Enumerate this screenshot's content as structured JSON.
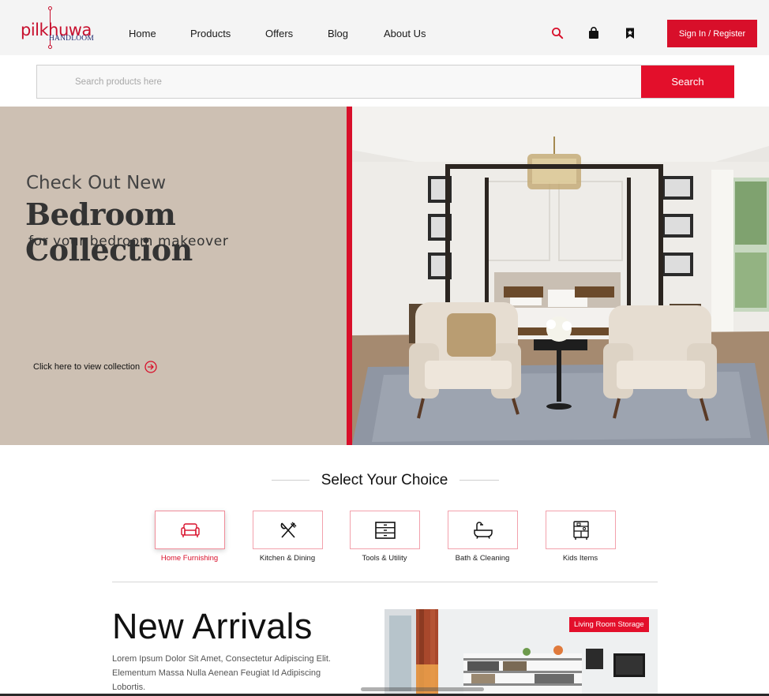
{
  "header": {
    "logo": {
      "main": "pilkhuwa",
      "sub": "HANDLOOM"
    },
    "nav": [
      "Home",
      "Products",
      "Offers",
      "Blog",
      "About Us"
    ],
    "icons": [
      "search-icon",
      "shopping-bag-icon",
      "bookmark-icon"
    ],
    "signin_label": "Sign In / Register"
  },
  "search": {
    "placeholder": "Search products here",
    "button_label": "Search"
  },
  "hero": {
    "line1": "Check Out New",
    "line2": "Bedroom Collection",
    "line3": "for your bedroom makeover",
    "cta": "Click here to view collection"
  },
  "choice": {
    "title": "Select Your Choice",
    "categories": [
      {
        "label": "Home Furnishing",
        "icon": "sofa-icon",
        "active": true
      },
      {
        "label": "Kitchen & Dining",
        "icon": "fork-knife-icon",
        "active": false
      },
      {
        "label": "Tools & Utility",
        "icon": "drawer-icon",
        "active": false
      },
      {
        "label": "Bath & Cleaning",
        "icon": "bathtub-icon",
        "active": false
      },
      {
        "label": "Kids Items",
        "icon": "kids-cabinet-icon",
        "active": false
      }
    ]
  },
  "new_arrivals": {
    "title": "New Arrivals",
    "body": "Lorem Ipsum Dolor Sit Amet, Consectetur Adipiscing Elit. Elementum Massa Nulla Aenean Feugiat Id Adipiscing Lobortis.",
    "badge": "Living Room Storage"
  },
  "colors": {
    "accent": "#d80f2a",
    "header_bg": "#f4f4f4",
    "hero_left_bg": "#cdc0b3",
    "navy": "#1e2a6e"
  }
}
